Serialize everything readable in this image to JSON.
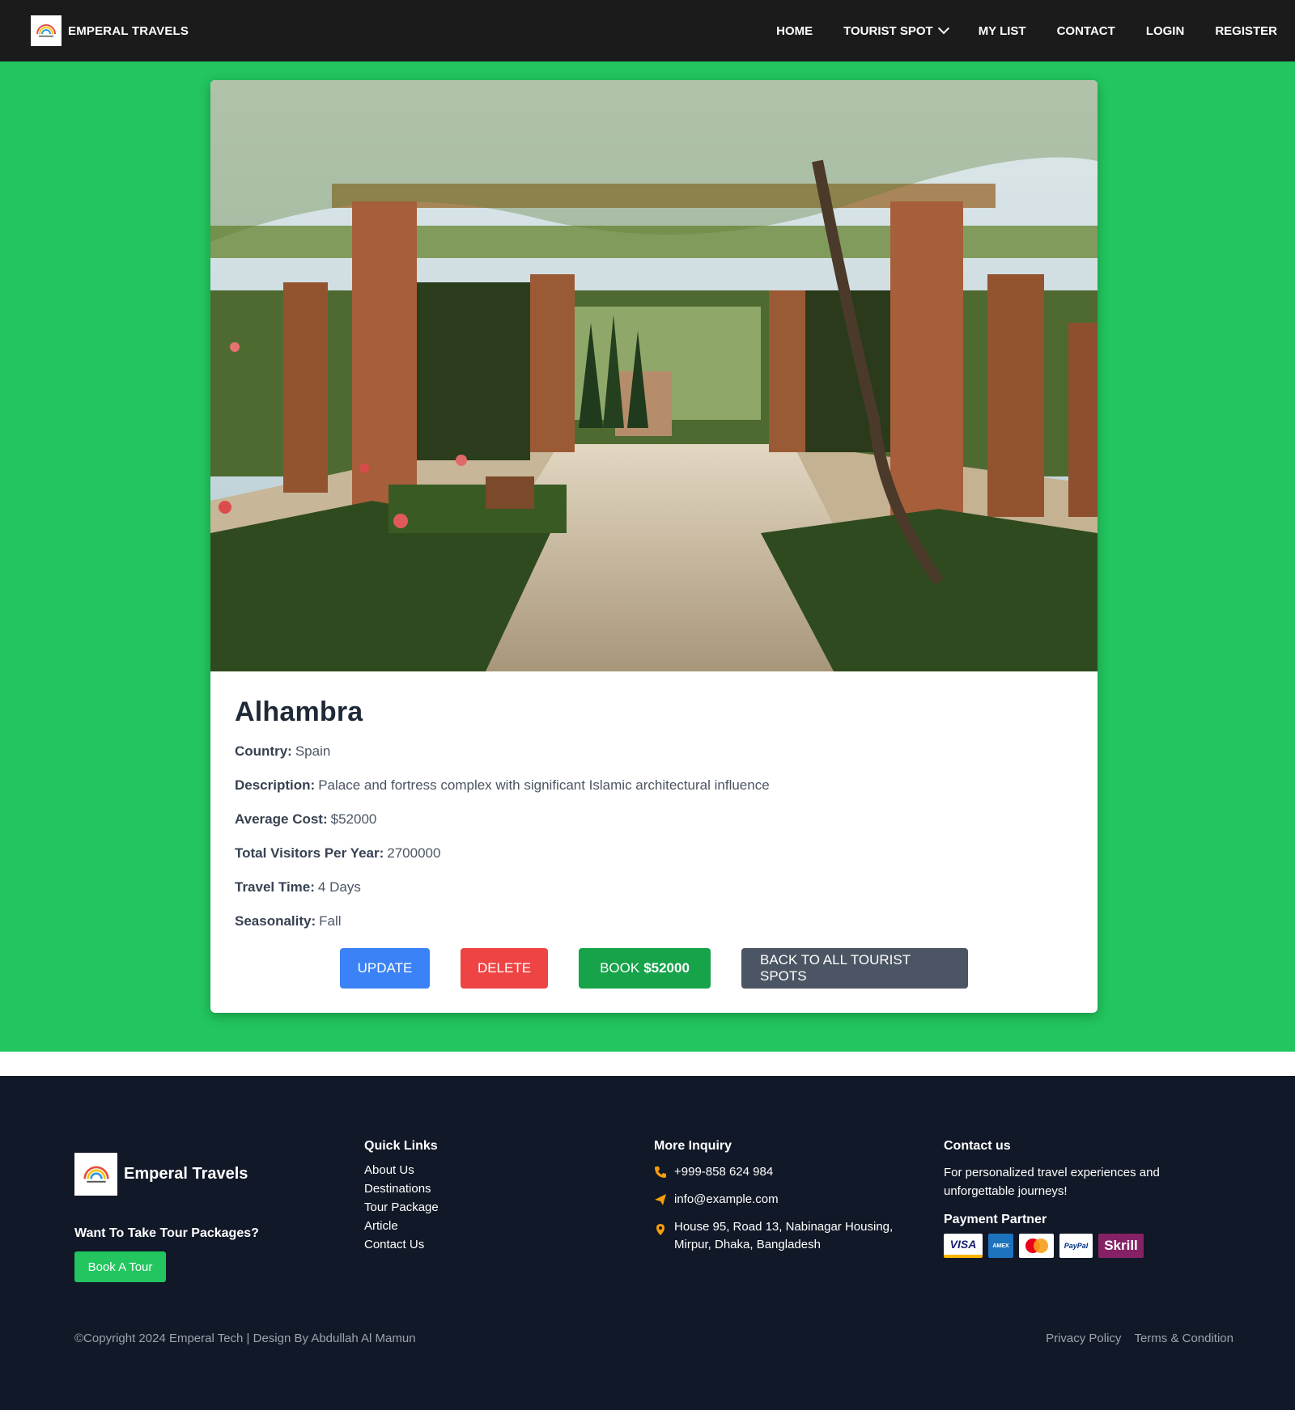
{
  "navbar": {
    "brand": "EMPERAL TRAVELS",
    "links": {
      "home": "HOME",
      "tourist_spot": "TOURIST SPOT",
      "my_list": "MY LIST",
      "contact": "CONTACT",
      "login": "LOGIN",
      "register": "REGISTER"
    }
  },
  "spot": {
    "name": "Alhambra",
    "fields": [
      {
        "label": "Country:",
        "value": "Spain"
      },
      {
        "label": "Description:",
        "value": "Palace and fortress complex with significant Islamic architectural influence"
      },
      {
        "label": "Average Cost:",
        "value": "$52000"
      },
      {
        "label": "Total Visitors Per Year:",
        "value": "2700000"
      },
      {
        "label": "Travel Time:",
        "value": "4 Days"
      },
      {
        "label": "Seasonality:",
        "value": "Fall"
      }
    ]
  },
  "actions": {
    "update": "UPDATE",
    "delete": "DELETE",
    "book_prefix": "BOOK",
    "book_price": "$52000",
    "back": "BACK TO ALL TOURIST SPOTS"
  },
  "footer": {
    "brand": "Emperal Travels",
    "want_tour": "Want To Take Tour Packages?",
    "book_tour": "Book A Tour",
    "quick_links": {
      "heading": "Quick Links",
      "items": [
        "About Us",
        "Destinations",
        "Tour Package",
        "Article",
        "Contact Us"
      ]
    },
    "inquiry": {
      "heading": "More Inquiry",
      "phone": "+999-858 624 984",
      "email": "info@example.com",
      "address": "House 95, Road 13, Nabinagar Housing, Mirpur, Dhaka, Bangladesh"
    },
    "contact": {
      "heading": "Contact us",
      "text": "For personalized travel experiences and unforgettable journeys!",
      "payment_heading": "Payment Partner",
      "payment_logos": [
        "VISA",
        "AMEX",
        "mastercard",
        "PayPal",
        "Skrill"
      ]
    },
    "copyright": "©Copyright 2024 Emperal Tech | Design By Abdullah Al Mamun",
    "privacy": "Privacy Policy",
    "terms": "Terms & Condition"
  },
  "colors": {
    "accent_green": "#22c55e",
    "nav_bg": "#1b1b1b",
    "footer_bg": "#111827",
    "update_btn": "#3b82f6",
    "delete_btn": "#ef4444",
    "book_btn": "#16a34a",
    "back_btn": "#4b5563"
  }
}
